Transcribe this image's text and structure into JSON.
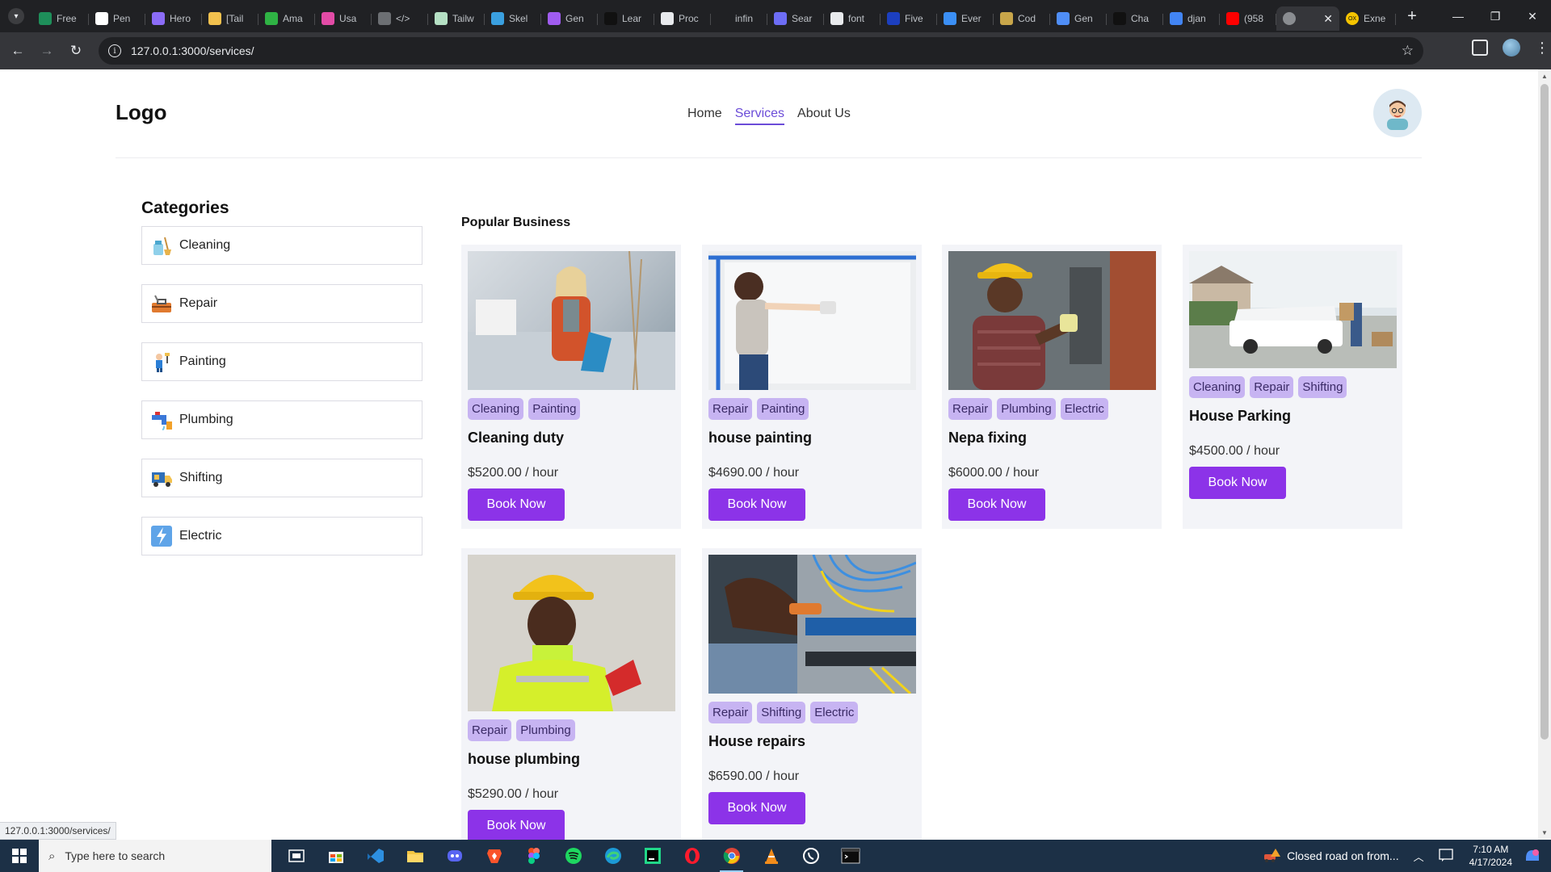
{
  "browser": {
    "tabs": [
      {
        "label": "Free",
        "color": "#1e8f5a"
      },
      {
        "label": "Pen",
        "color": "#ffffff"
      },
      {
        "label": "Hero",
        "color": "#8b6cf7"
      },
      {
        "label": "[Tail",
        "color": "#f2c14e"
      },
      {
        "label": "Ama",
        "color": "#2fb344"
      },
      {
        "label": "Usa",
        "color": "#e24ba6"
      },
      {
        "label": "</>",
        "color": "#6c6f73"
      },
      {
        "label": "Tailw",
        "color": "#b5e0c4"
      },
      {
        "label": "Skel",
        "color": "#3aa0e0"
      },
      {
        "label": "Gen",
        "color": "#a05cf0"
      },
      {
        "label": "Lear",
        "color": "#111111"
      },
      {
        "label": "Proc",
        "color": "#e8eaed"
      },
      {
        "label": "infin",
        "color": "#202124"
      },
      {
        "label": "Sear",
        "color": "#6d6df5"
      },
      {
        "label": "font",
        "color": "#e8eaed"
      },
      {
        "label": "Five",
        "color": "#1c3fbf"
      },
      {
        "label": "Ever",
        "color": "#3b8ff5"
      },
      {
        "label": "Cod",
        "color": "#c8a64a"
      },
      {
        "label": "Gen",
        "color": "#4f8ef7"
      },
      {
        "label": "Cha",
        "color": "#111111"
      },
      {
        "label": "djan",
        "color": "#4285f4"
      },
      {
        "label": "(958",
        "color": "#ff0000"
      }
    ],
    "active_tab": {
      "label": "",
      "color": "#8a8d91"
    },
    "last_tab": {
      "label": "Exne",
      "color": "#f5c400",
      "text": "OX"
    },
    "url": "127.0.0.1:3000/services/"
  },
  "site": {
    "logo": "Logo",
    "nav": [
      "Home",
      "Services",
      "About Us"
    ],
    "current_nav": "Services"
  },
  "categories": {
    "title": "Categories",
    "items": [
      {
        "label": "Cleaning",
        "icon": "cleaning-icon"
      },
      {
        "label": "Repair",
        "icon": "toolbox-icon"
      },
      {
        "label": "Painting",
        "icon": "painter-icon"
      },
      {
        "label": "Plumbing",
        "icon": "faucet-icon"
      },
      {
        "label": "Shifting",
        "icon": "truck-icon"
      },
      {
        "label": "Electric",
        "icon": "lightning-icon"
      }
    ]
  },
  "popular": {
    "title": "Popular Business",
    "cards": [
      {
        "title": "Cleaning duty",
        "tags": [
          "Cleaning",
          "Painting"
        ],
        "price": "$5200.00 / hour",
        "button": "Book Now",
        "image": "cleaning-photo"
      },
      {
        "title": "house painting",
        "tags": [
          "Repair",
          "Painting"
        ],
        "price": "$4690.00 / hour",
        "button": "Book Now",
        "image": "painting-photo"
      },
      {
        "title": "Nepa fixing",
        "tags": [
          "Repair",
          "Plumbing",
          "Electric"
        ],
        "price": "$6000.00 / hour",
        "button": "Book Now",
        "image": "electrician-photo"
      },
      {
        "title": "House Parking",
        "tags": [
          "Cleaning",
          "Repair",
          "Shifting"
        ],
        "price": "$4500.00 / hour",
        "button": "Book Now",
        "image": "moving-van-photo"
      },
      {
        "title": "house plumbing",
        "tags": [
          "Repair",
          "Plumbing"
        ],
        "price": "$5290.00 / hour",
        "button": "Book Now",
        "image": "worker-hardhat-photo"
      },
      {
        "title": "House repairs",
        "tags": [
          "Repair",
          "Shifting",
          "Electric"
        ],
        "price": "$6590.00 / hour",
        "button": "Book Now",
        "image": "network-rack-photo"
      }
    ]
  },
  "status_bar_url": "127.0.0.1:3000/services/",
  "taskbar": {
    "search_placeholder": "Type here to search",
    "news": "Closed road on from...",
    "time": "7:10 AM",
    "date": "4/17/2024"
  },
  "colors": {
    "accent": "#8c33e8",
    "tag_bg": "#c7b4f2",
    "nav_active": "#6b4cd8"
  }
}
